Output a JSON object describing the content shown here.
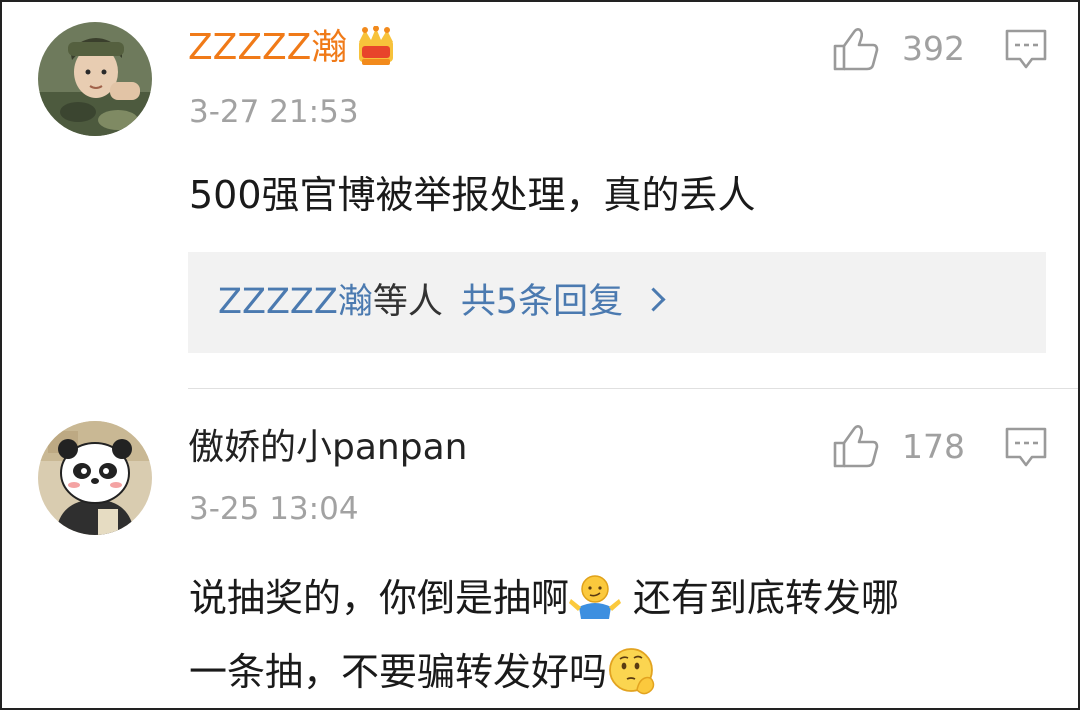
{
  "comments": [
    {
      "username": "ZZZZZ瀚",
      "vip_badge": "crown-icon",
      "time": "3-27 21:53",
      "likes": "392",
      "content": "500强官博被举报处理，真的丢人",
      "replies": {
        "name": "ZZZZZ瀚",
        "mid": "等人",
        "total": "共5条回复"
      }
    },
    {
      "username": "傲娇的小panpan",
      "time": "3-25 13:04",
      "likes": "178",
      "content_line1_a": "说抽奖的，你倒是抽啊",
      "content_line1_b": "还有到底转发哪",
      "content_line2_a": "一条抽，不要骗转发好吗",
      "emoji1": "shrug-emoji",
      "emoji2": "thinking-emoji"
    }
  ],
  "colors": {
    "vip_name": "#f07a18",
    "link_blue": "#4b7ab0",
    "meta_gray": "#a2a2a2",
    "reply_bg": "#f2f2f2"
  }
}
